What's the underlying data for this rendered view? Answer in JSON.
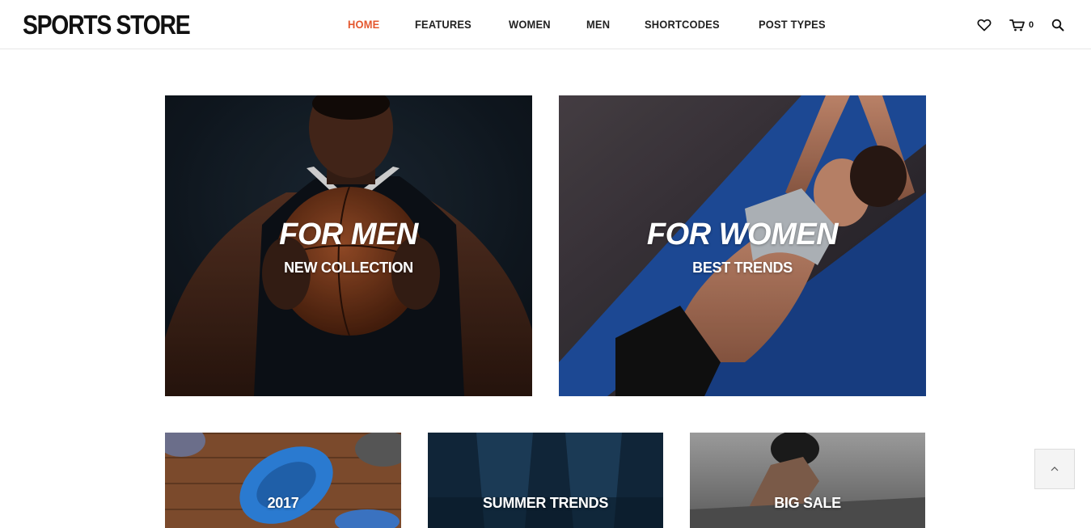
{
  "header": {
    "logo": "SPORTS STORE",
    "nav": [
      "HOME",
      "FEATURES",
      "WOMEN",
      "MEN",
      "SHORTCODES",
      "POST TYPES"
    ],
    "active_nav": "HOME",
    "cart_count": "0",
    "accent_color": "#e4572e"
  },
  "banners": {
    "men": {
      "title": "FOR MEN",
      "subtitle": "NEW COLLECTION"
    },
    "women": {
      "title": "FOR WOMEN",
      "subtitle": "BEST TRENDS"
    }
  },
  "tiles": [
    {
      "label": "2017"
    },
    {
      "label": "SUMMER TRENDS"
    },
    {
      "label": "BIG SALE"
    }
  ],
  "icons": [
    "heart-icon",
    "cart-icon",
    "search-icon",
    "chevron-up-icon"
  ]
}
